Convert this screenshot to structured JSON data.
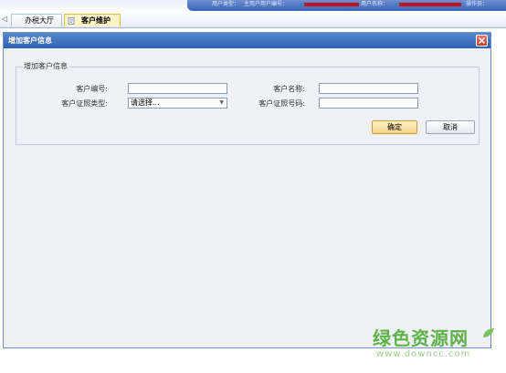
{
  "header": {
    "user_type_label": "用户类型：",
    "user_type_value": "主用户",
    "user_id_label": "用户编号：",
    "user_name_label": "用户名称：",
    "operator_label": "操作员：",
    "redacted_color": "#c0141e"
  },
  "tabs": [
    {
      "label": "办税大厅"
    },
    {
      "label": "客户维护",
      "active": true
    }
  ],
  "dialog": {
    "title": "增加客户信息",
    "fieldset_legend": "增加客户信息",
    "fields": {
      "customer_id": {
        "label": "客户编号:",
        "value": ""
      },
      "customer_name": {
        "label": "客户名称:",
        "value": ""
      },
      "id_type": {
        "label": "客户证照类型:",
        "selected": "请选择..."
      },
      "id_number": {
        "label": "客户证照号码:",
        "value": ""
      }
    },
    "buttons": {
      "ok": "确定",
      "cancel": "取消"
    }
  },
  "watermark": {
    "text": "绿色资源网",
    "url": "www.downcc.com",
    "color": "#5fb248"
  },
  "colors": {
    "titlebar": "#3a6cbf",
    "dialog_bg": "#eef1f7",
    "active_tab": "#fff4c5"
  }
}
